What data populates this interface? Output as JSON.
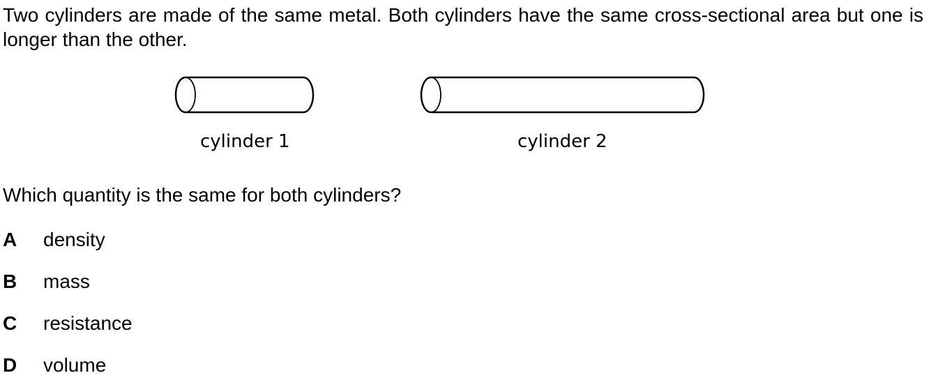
{
  "intro": "Two cylinders are made of the same metal. Both cylinders have the same cross-sectional area but one is longer than the other.",
  "figure": {
    "cylinder_1_label": "cylinder 1",
    "cylinder_2_label": "cylinder 2"
  },
  "question": "Which quantity is the same for both cylinders?",
  "options": [
    {
      "letter": "A",
      "text": "density"
    },
    {
      "letter": "B",
      "text": "mass"
    },
    {
      "letter": "C",
      "text": "resistance"
    },
    {
      "letter": "D",
      "text": "volume"
    }
  ]
}
